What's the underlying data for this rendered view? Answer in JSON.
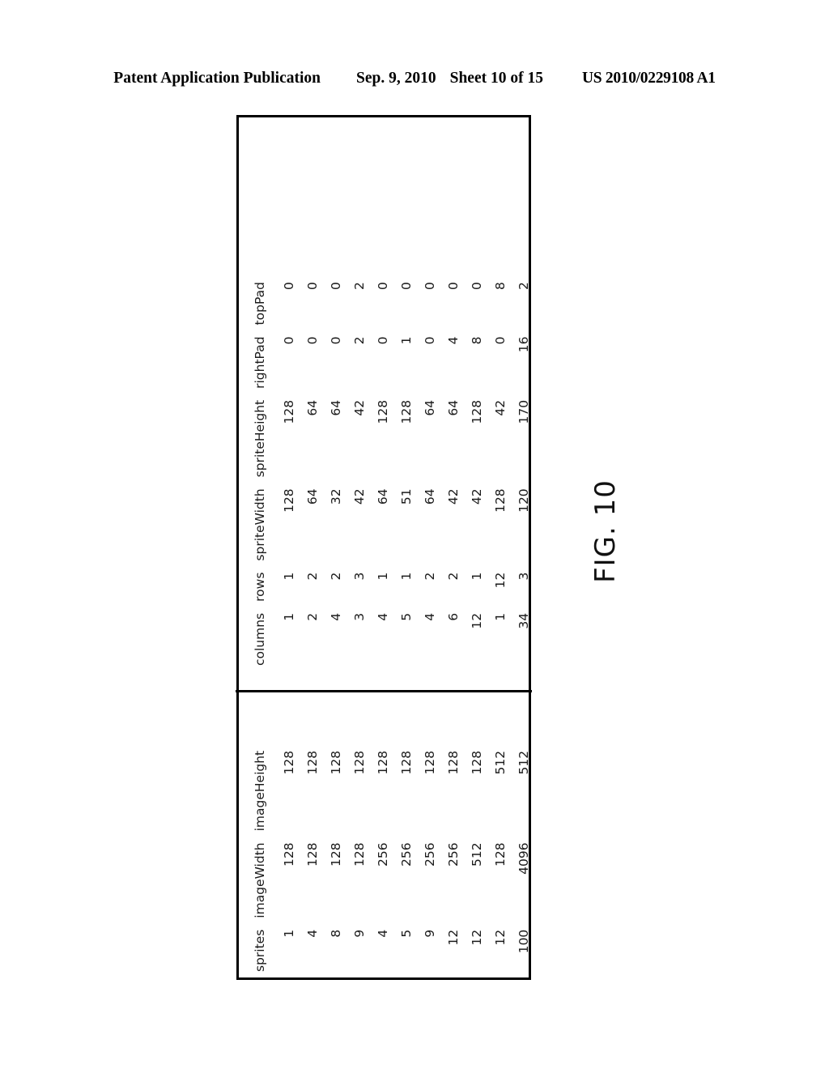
{
  "header": {
    "publication": "Patent Application Publication",
    "date": "Sep. 9, 2010",
    "sheet": "Sheet 10 of 15",
    "patent_number": "US 2010/0229108 A1"
  },
  "figure": {
    "caption": "FIG. 10"
  },
  "table": {
    "left_headers": [
      "sprites",
      "imageWidth",
      "imageHeight"
    ],
    "right_headers": [
      "columns",
      "rows",
      "spriteWidth",
      "spriteHeight",
      "rightPad",
      "topPad"
    ],
    "headers": [
      "sprites",
      "imageWidth",
      "imageHeight",
      "columns",
      "rows",
      "spriteWidth",
      "spriteHeight",
      "rightPad",
      "topPad"
    ],
    "rows": [
      {
        "sprites": "1",
        "imageWidth": "128",
        "imageHeight": "128",
        "columns": "1",
        "rows": "1",
        "spriteWidth": "128",
        "spriteHeight": "128",
        "rightPad": "0",
        "topPad": "0"
      },
      {
        "sprites": "4",
        "imageWidth": "128",
        "imageHeight": "128",
        "columns": "2",
        "rows": "2",
        "spriteWidth": "64",
        "spriteHeight": "64",
        "rightPad": "0",
        "topPad": "0"
      },
      {
        "sprites": "8",
        "imageWidth": "128",
        "imageHeight": "128",
        "columns": "4",
        "rows": "2",
        "spriteWidth": "32",
        "spriteHeight": "64",
        "rightPad": "0",
        "topPad": "0"
      },
      {
        "sprites": "9",
        "imageWidth": "128",
        "imageHeight": "128",
        "columns": "3",
        "rows": "3",
        "spriteWidth": "42",
        "spriteHeight": "42",
        "rightPad": "2",
        "topPad": "2"
      },
      {
        "sprites": "4",
        "imageWidth": "256",
        "imageHeight": "128",
        "columns": "4",
        "rows": "1",
        "spriteWidth": "64",
        "spriteHeight": "128",
        "rightPad": "0",
        "topPad": "0"
      },
      {
        "sprites": "5",
        "imageWidth": "256",
        "imageHeight": "128",
        "columns": "5",
        "rows": "1",
        "spriteWidth": "51",
        "spriteHeight": "128",
        "rightPad": "1",
        "topPad": "0"
      },
      {
        "sprites": "9",
        "imageWidth": "256",
        "imageHeight": "128",
        "columns": "4",
        "rows": "2",
        "spriteWidth": "64",
        "spriteHeight": "64",
        "rightPad": "0",
        "topPad": "0"
      },
      {
        "sprites": "12",
        "imageWidth": "256",
        "imageHeight": "128",
        "columns": "6",
        "rows": "2",
        "spriteWidth": "42",
        "spriteHeight": "64",
        "rightPad": "4",
        "topPad": "0"
      },
      {
        "sprites": "12",
        "imageWidth": "512",
        "imageHeight": "128",
        "columns": "12",
        "rows": "1",
        "spriteWidth": "42",
        "spriteHeight": "128",
        "rightPad": "8",
        "topPad": "0"
      },
      {
        "sprites": "12",
        "imageWidth": "128",
        "imageHeight": "512",
        "columns": "1",
        "rows": "12",
        "spriteWidth": "128",
        "spriteHeight": "42",
        "rightPad": "0",
        "topPad": "8"
      },
      {
        "sprites": "100",
        "imageWidth": "4096",
        "imageHeight": "512",
        "columns": "34",
        "rows": "3",
        "spriteWidth": "120",
        "spriteHeight": "170",
        "rightPad": "16",
        "topPad": "2"
      }
    ]
  }
}
